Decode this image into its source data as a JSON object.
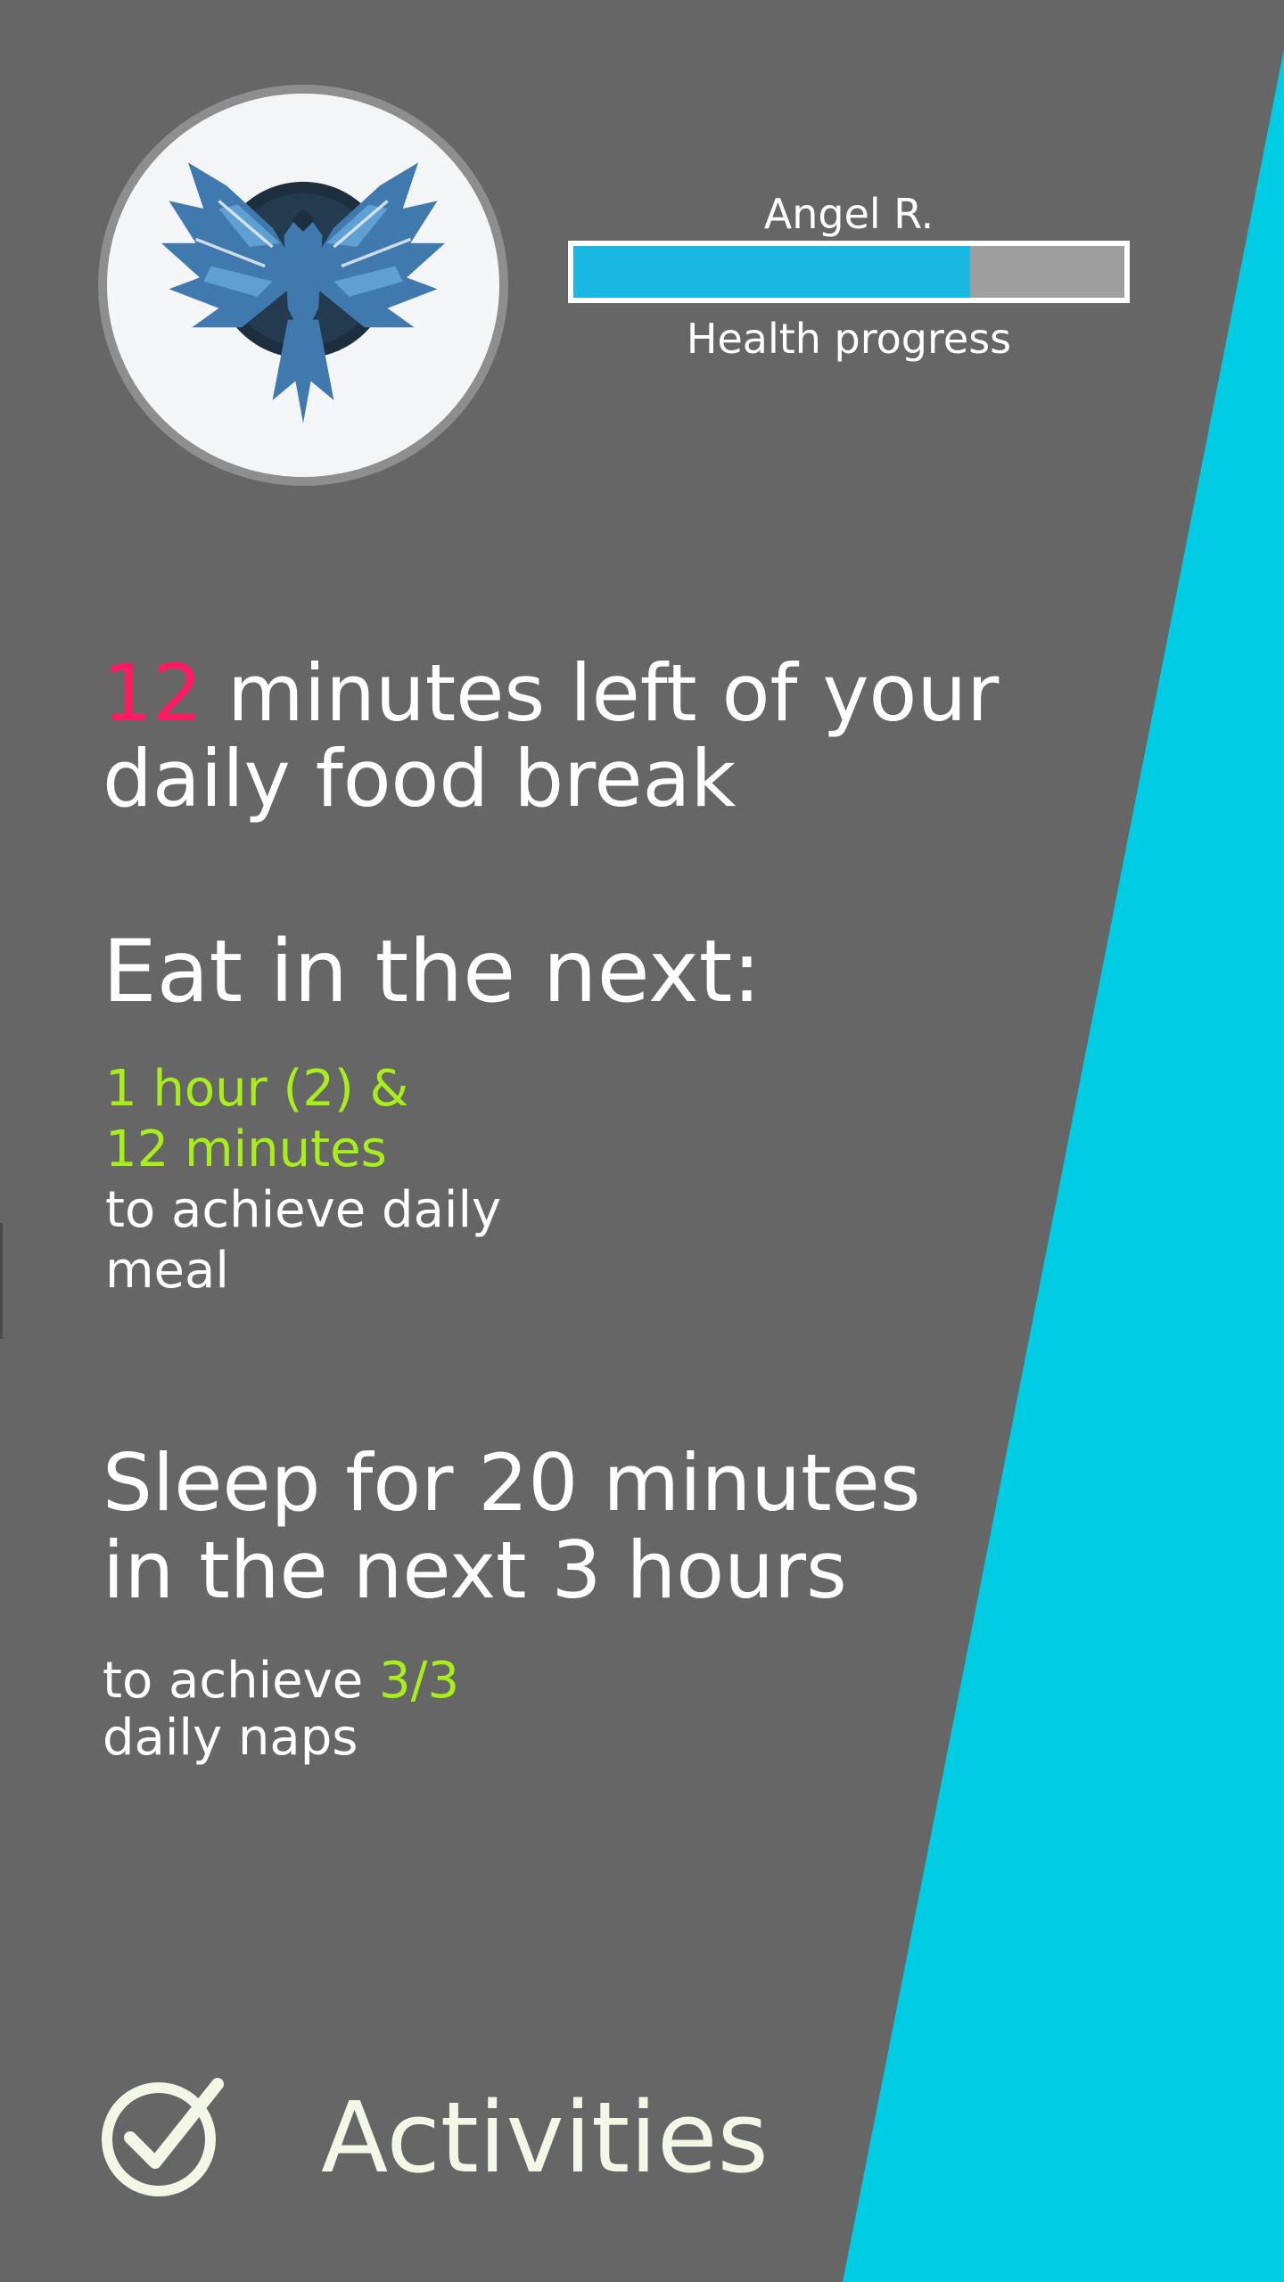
{
  "header": {
    "avatar_icon": "phoenix-emblem",
    "user_name": "Angel R.",
    "progress_caption": "Health progress",
    "progress_fraction": 0.72
  },
  "food_break": {
    "minutes": "12",
    "text_line1": "minutes left of your",
    "text_line2": "daily food break"
  },
  "eat": {
    "title": "Eat in the next:",
    "time_line1": "1 hour (2) &",
    "time_line2": "12 minutes",
    "goal_line1": "to achieve daily",
    "goal_line2": "meal"
  },
  "sleep": {
    "title_line1": "Sleep for 20 minutes",
    "title_line2": "in the next 3 hours",
    "goal_prefix": "to achieve",
    "goal_count": "3/3",
    "goal_line2": "daily naps"
  },
  "footer": {
    "activities_icon": "checkmark-circle-icon",
    "activities_label": "Activities"
  },
  "colors": {
    "background": "#666666",
    "stripe": "#00cde4",
    "accent_red": "#ff1a63",
    "accent_green": "#a8ee1a",
    "progress_fill": "#1ab7e2",
    "progress_track": "#9e9e9e"
  }
}
